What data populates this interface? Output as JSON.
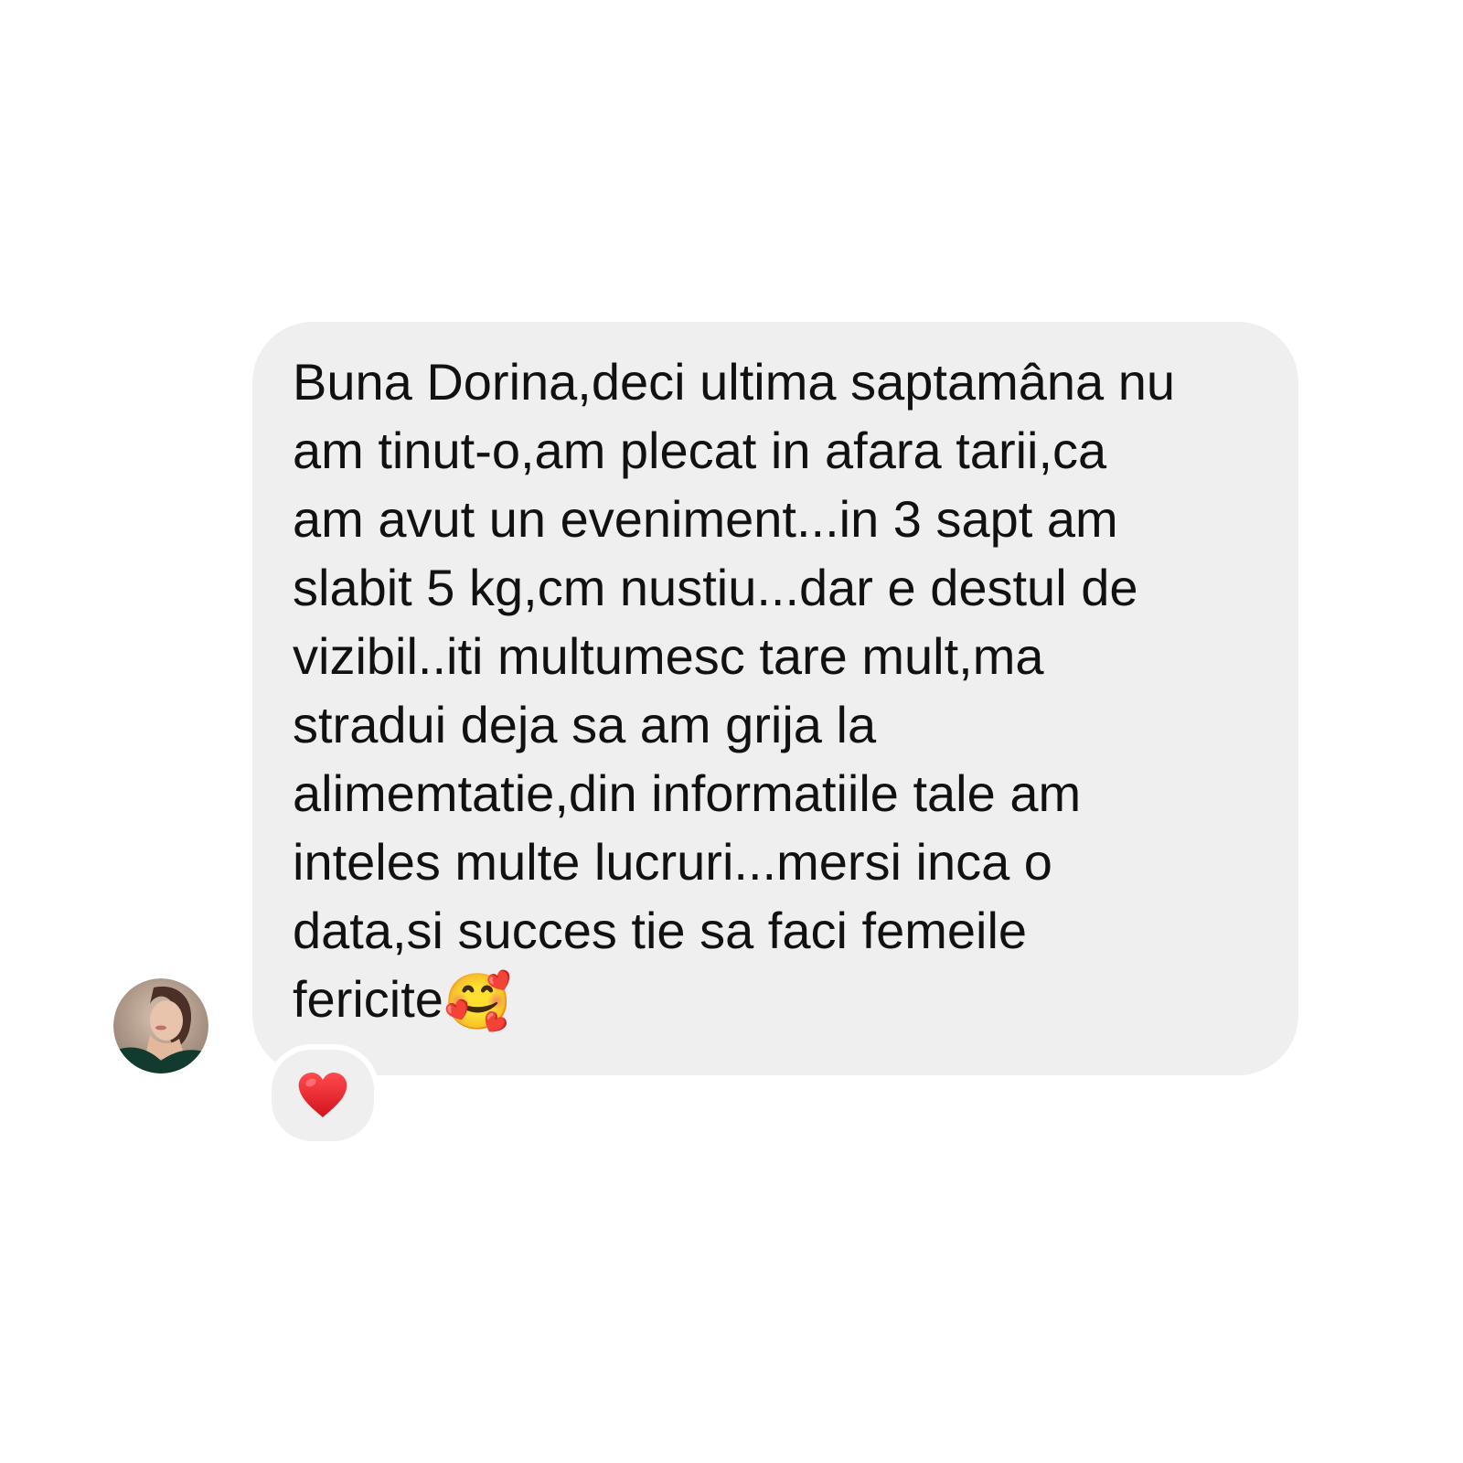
{
  "conversation": {
    "message": {
      "lines": [
        "Buna Dorina,deci ultima saptamâna nu",
        "am tinut-o,am plecat in afara tarii,ca",
        "am avut un eveniment...in 3 sapt am",
        "slabit 5 kg,cm nustiu...dar e destul de",
        "vizibil..iti multumesc tare mult,ma",
        "stradui deja sa am grija la",
        "alimemtatie,din informatiile tale am",
        "inteles multe lucruri...mersi inca o",
        "data,si succes tie sa faci femeile",
        "fericite"
      ],
      "trailing_emoji": "🥰",
      "bubble_color": "#efefef",
      "text_color": "#111111"
    },
    "sender_avatar": {
      "icon": "profile-photo-avatar"
    },
    "reaction": {
      "icon": "red-heart-icon",
      "color": "#e8202a"
    }
  }
}
